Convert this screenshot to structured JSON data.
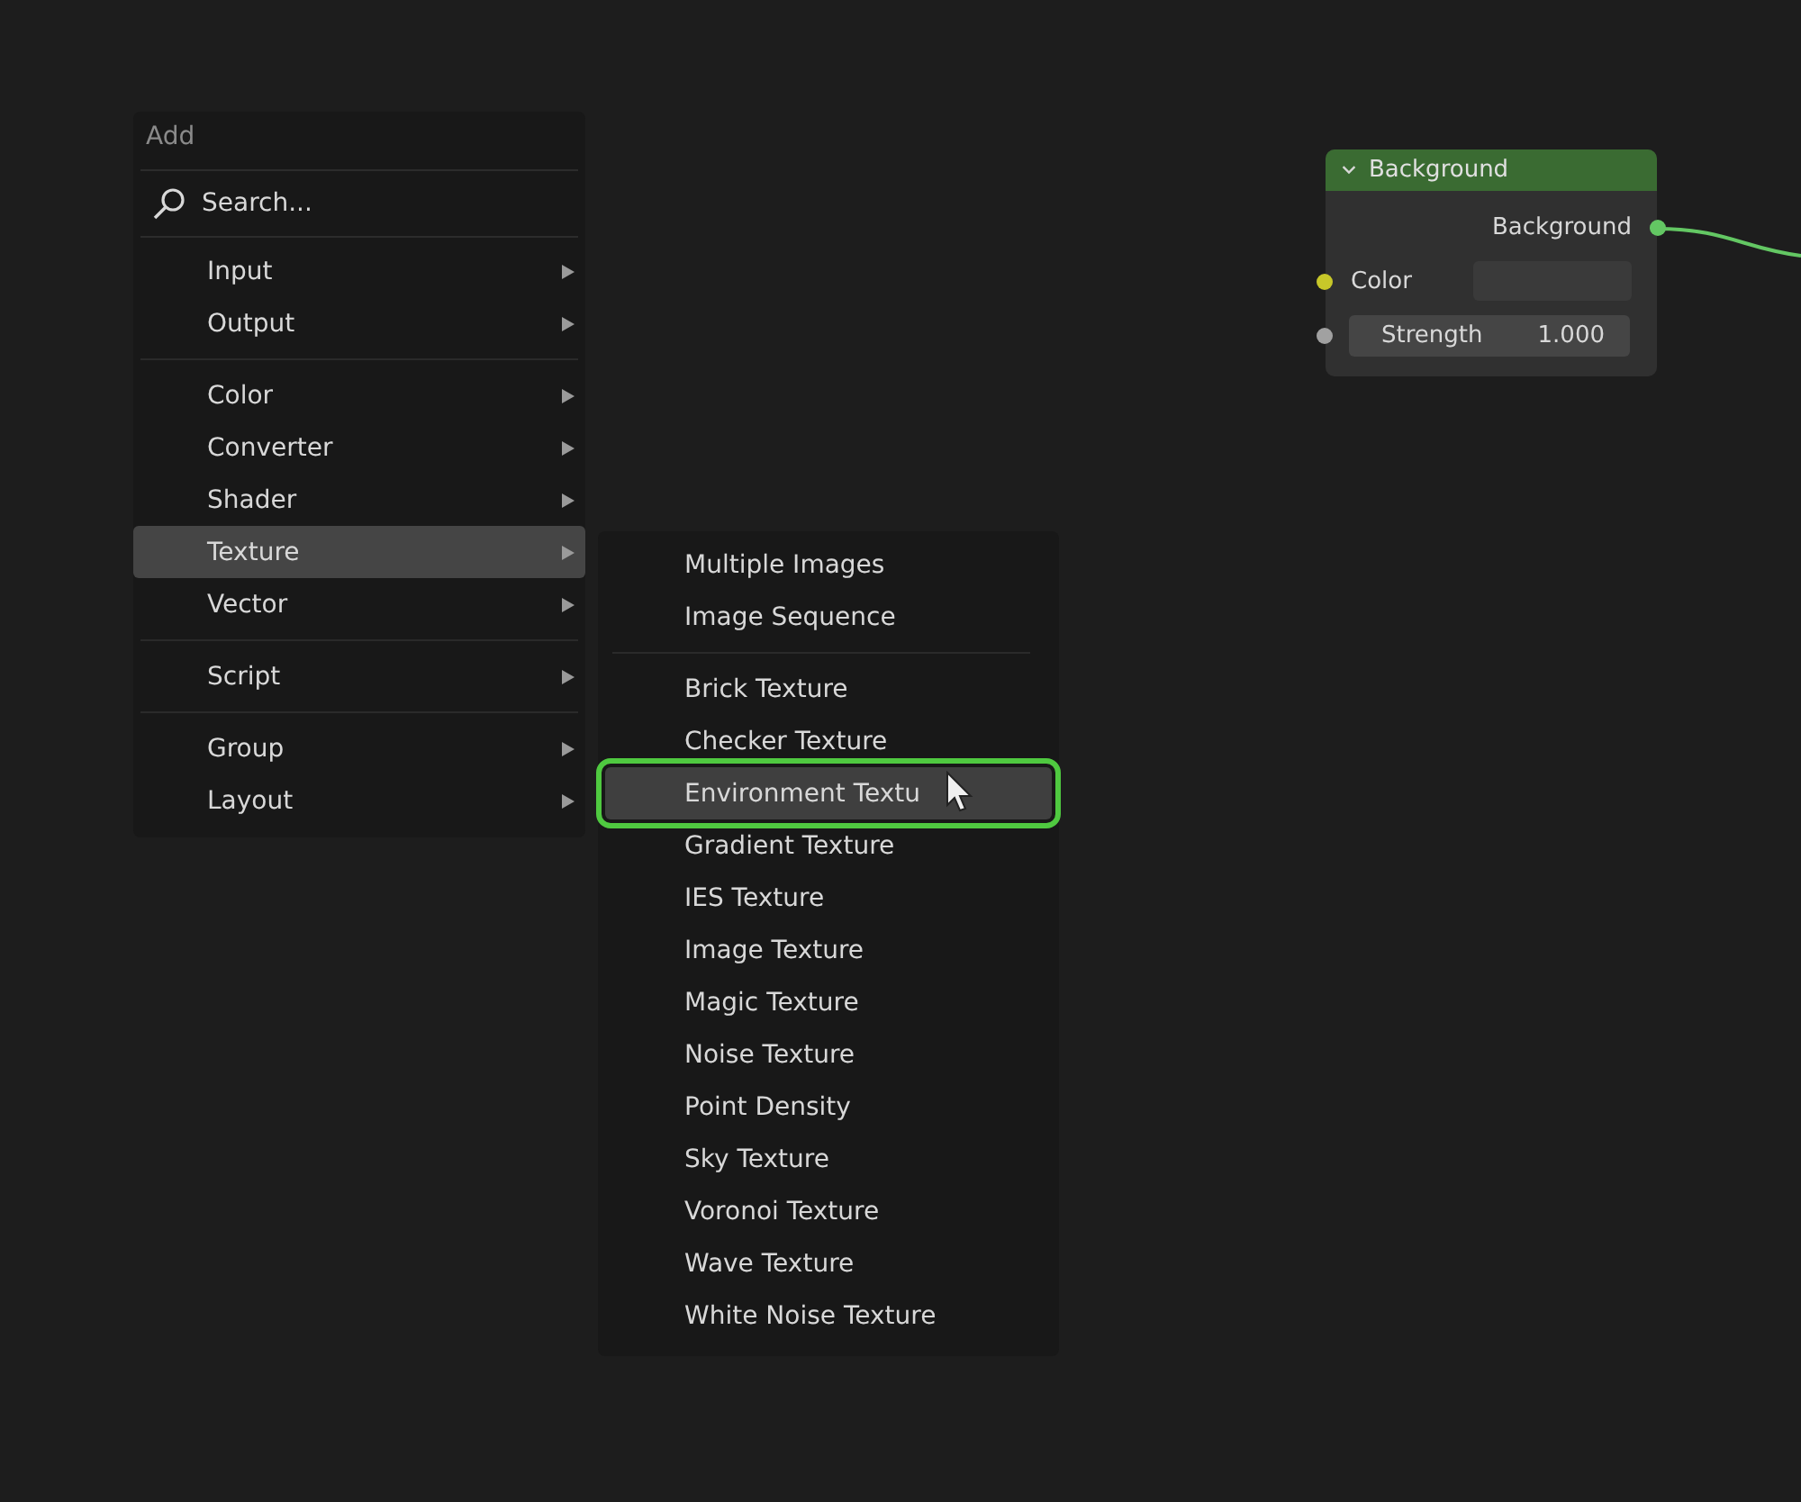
{
  "add_menu": {
    "title": "Add",
    "search": {
      "placeholder": "Search..."
    },
    "items": [
      {
        "kind": "item",
        "label": "Input",
        "selected": false
      },
      {
        "kind": "item",
        "label": "Output",
        "selected": false
      },
      {
        "kind": "separator"
      },
      {
        "kind": "item",
        "label": "Color",
        "selected": false
      },
      {
        "kind": "item",
        "label": "Converter",
        "selected": false
      },
      {
        "kind": "item",
        "label": "Shader",
        "selected": false
      },
      {
        "kind": "item",
        "label": "Texture",
        "selected": true
      },
      {
        "kind": "item",
        "label": "Vector",
        "selected": false
      },
      {
        "kind": "separator"
      },
      {
        "kind": "item",
        "label": "Script",
        "selected": false
      },
      {
        "kind": "separator"
      },
      {
        "kind": "item",
        "label": "Group",
        "selected": false
      },
      {
        "kind": "item",
        "label": "Layout",
        "selected": false
      }
    ]
  },
  "texture_submenu": {
    "items": [
      {
        "kind": "item",
        "label": "Multiple Images",
        "selected": false
      },
      {
        "kind": "item",
        "label": "Image Sequence",
        "selected": false
      },
      {
        "kind": "separator"
      },
      {
        "kind": "item",
        "label": "Brick Texture",
        "selected": false
      },
      {
        "kind": "item",
        "label": "Checker Texture",
        "selected": false
      },
      {
        "kind": "item",
        "label": "Environment Textu",
        "selected": true
      },
      {
        "kind": "item",
        "label": "Gradient Texture",
        "selected": false
      },
      {
        "kind": "item",
        "label": "IES Texture",
        "selected": false
      },
      {
        "kind": "item",
        "label": "Image Texture",
        "selected": false
      },
      {
        "kind": "item",
        "label": "Magic Texture",
        "selected": false
      },
      {
        "kind": "item",
        "label": "Noise Texture",
        "selected": false
      },
      {
        "kind": "item",
        "label": "Point Density",
        "selected": false
      },
      {
        "kind": "item",
        "label": "Sky Texture",
        "selected": false
      },
      {
        "kind": "item",
        "label": "Voronoi Texture",
        "selected": false
      },
      {
        "kind": "item",
        "label": "Wave Texture",
        "selected": false
      },
      {
        "kind": "item",
        "label": "White Noise Texture",
        "selected": false
      }
    ]
  },
  "node": {
    "title": "Background",
    "expanded": true,
    "outputs": [
      {
        "label": "Background",
        "color": "#63c763"
      }
    ],
    "inputs": [
      {
        "kind": "color",
        "label": "Color",
        "color": "#c7c729"
      },
      {
        "kind": "value",
        "label": "Strength",
        "value": "1.000",
        "color": "#a1a1a1"
      }
    ]
  }
}
